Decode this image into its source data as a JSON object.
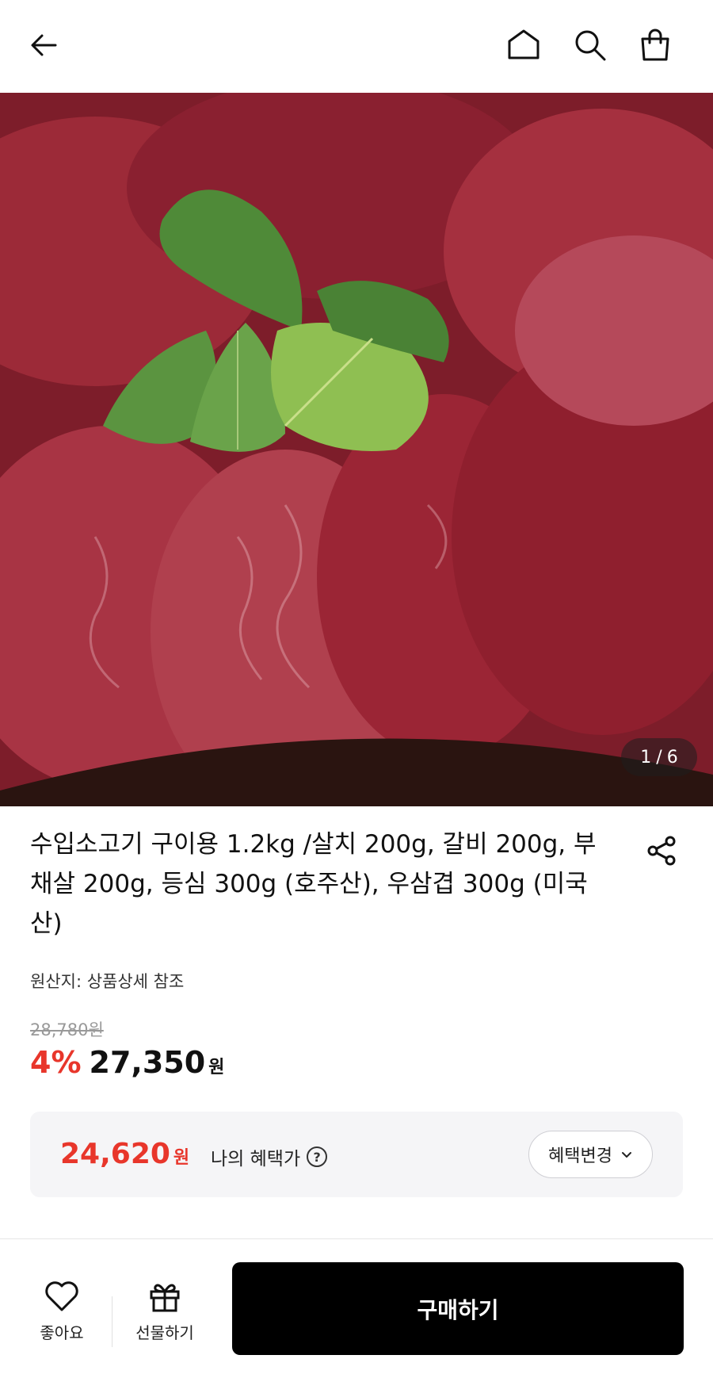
{
  "header": {
    "back_icon": "arrow-left-icon",
    "home_icon": "home-icon",
    "search_icon": "search-icon",
    "bag_icon": "shopping-bag-icon"
  },
  "gallery": {
    "current": "1",
    "separator": "/",
    "total": "6"
  },
  "product": {
    "title": "수입소고기 구이용 1.2kg /살치 200g, 갈비 200g, 부채살 200g, 등심 300g (호주산), 우삼겹 300g (미국산)",
    "origin": "원산지: 상품상세 참조",
    "original_price": "28,780원",
    "discount": "4%",
    "price": "27,350",
    "price_unit": "원"
  },
  "benefit": {
    "price": "24,620",
    "price_unit": "원",
    "label": "나의 혜택가",
    "help_icon": "question-circle-icon",
    "change_label": "혜택변경"
  },
  "bottom_bar": {
    "like_label": "좋아요",
    "gift_label": "선물하기",
    "buy_label": "구매하기"
  },
  "colors": {
    "accent_red": "#e8362b",
    "buy_button": "#000000"
  }
}
